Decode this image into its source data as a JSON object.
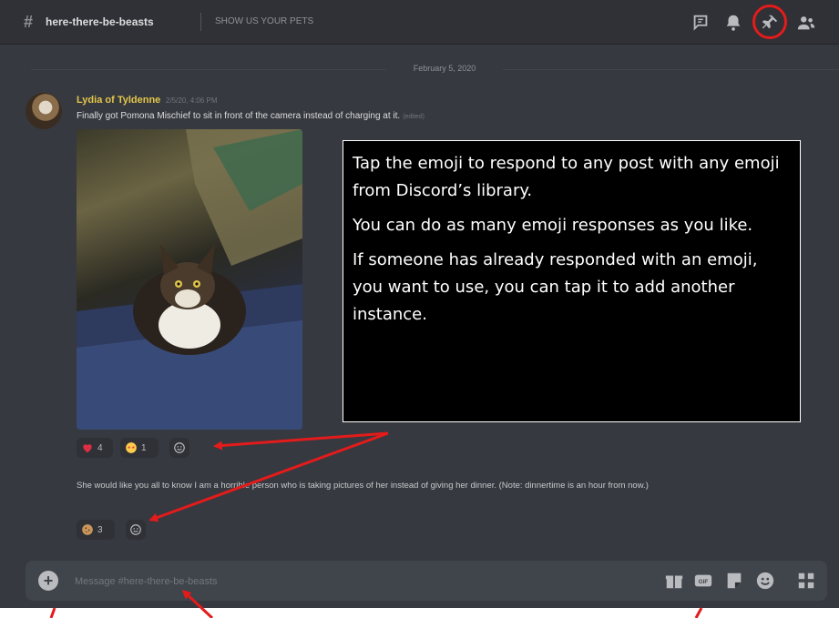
{
  "channel": {
    "name": "here-there-be-beasts",
    "topic": "SHOW US YOUR PETS"
  },
  "date_divider": "February 5, 2020",
  "message": {
    "author": "Lydia of Tyldenne",
    "timestamp": "2/5/20, 4:06 PM",
    "text": "Finally got Pomona Mischief to sit in front of the camera instead of charging at it.",
    "edited": "(edited)",
    "reactions": [
      {
        "emoji": "heart",
        "count": "4"
      },
      {
        "emoji": "star-struck",
        "count": "1"
      }
    ],
    "text2": "She would like you all to know I am a horrible person who is taking pictures of her instead of giving her dinner. (Note: dinnertime is an hour from now.)",
    "reactions2": [
      {
        "emoji": "cookie",
        "count": "3"
      }
    ]
  },
  "callout": {
    "p1": "Tap the emoji to respond to any post with any emoji from Discord’s library.",
    "p2": "You can do as many emoji responses as you like.",
    "p3": "If someone has already responded with an emoji, you want to use, you can tap it to add another instance."
  },
  "composer": {
    "placeholder": "Message #here-there-be-beasts"
  },
  "colors": {
    "background": "#36393f",
    "header": "#2f3136",
    "author": "#e3c64a",
    "annotation": "#e41b1b"
  },
  "icons": [
    "hash-icon",
    "threads-icon",
    "notifications-icon",
    "pin-icon",
    "members-icon",
    "add-reaction-icon",
    "attach-plus-icon",
    "gift-icon",
    "gif-icon",
    "sticker-icon",
    "emoji-icon",
    "apps-icon"
  ]
}
